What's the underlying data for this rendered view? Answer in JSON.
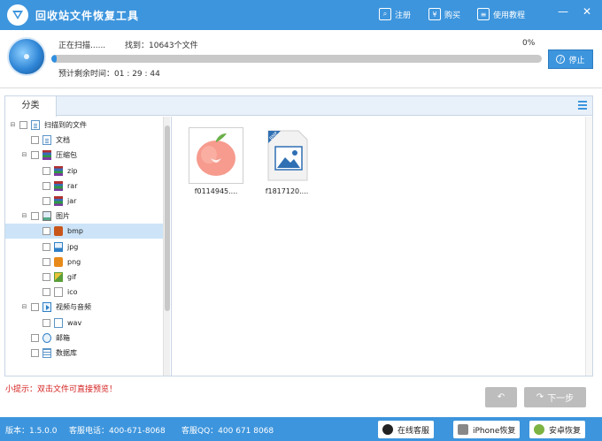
{
  "app": {
    "title": "回收站文件恢复工具"
  },
  "titlebar": {
    "register_label": "注册",
    "buy_label": "购买",
    "tutorial_label": "使用教程",
    "minimize_glyph": "—",
    "close_glyph": "✕"
  },
  "scan": {
    "status": "正在扫描......",
    "found": "找到：10643个文件",
    "percent": "0%",
    "progress_fraction": 0.01,
    "time_left": "预计剩余时间：01 : 29 : 44",
    "stop_label": "停止"
  },
  "panel": {
    "tab_label": "分类"
  },
  "tree": [
    {
      "label": "扫描到的文件",
      "icon": "doc",
      "expander": "⊟",
      "level": 0
    },
    {
      "label": "文档",
      "icon": "doc",
      "expander": "",
      "level": 1
    },
    {
      "label": "压缩包",
      "icon": "zip",
      "expander": "⊟",
      "level": 1
    },
    {
      "label": "zip",
      "icon": "zip",
      "expander": "",
      "level": 2
    },
    {
      "label": "rar",
      "icon": "zip",
      "expander": "",
      "level": 2
    },
    {
      "label": "jar",
      "icon": "zip",
      "expander": "",
      "level": 2
    },
    {
      "label": "图片",
      "icon": "img",
      "expander": "⊟",
      "level": 1
    },
    {
      "label": "bmp",
      "icon": "bmp",
      "expander": "",
      "level": 2,
      "selected": true
    },
    {
      "label": "jpg",
      "icon": "jpg",
      "expander": "",
      "level": 2
    },
    {
      "label": "png",
      "icon": "png",
      "expander": "",
      "level": 2
    },
    {
      "label": "gif",
      "icon": "gif",
      "expander": "",
      "level": 2
    },
    {
      "label": "ico",
      "icon": "ico",
      "expander": "",
      "level": 2
    },
    {
      "label": "视频与音频",
      "icon": "video",
      "expander": "⊟",
      "level": 1
    },
    {
      "label": "wav",
      "icon": "wav",
      "expander": "",
      "level": 2
    },
    {
      "label": "邮箱",
      "icon": "mail",
      "expander": "",
      "level": 1
    },
    {
      "label": "数据库",
      "icon": "db",
      "expander": "",
      "level": 1
    }
  ],
  "files": [
    {
      "name": "f0114945....",
      "kind": "apple-photo"
    },
    {
      "name": "f1817120....",
      "kind": "bmp-generic",
      "badge": "BMP"
    }
  ],
  "tip": "小提示：双击文件可直接预览！",
  "nav": {
    "back_glyph": "↶",
    "next_label": "下一步",
    "next_glyph": "↷"
  },
  "statusbar": {
    "version": "版本：1.5.0.0",
    "phone": "客服电话：400-671-8068",
    "qq": "客服QQ：400 671 8068",
    "online_service": "在线客服",
    "iphone_recovery": "iPhone恢复",
    "android_recovery": "安卓恢复"
  },
  "colors": {
    "accent": "#3d95dd",
    "tip": "#d42020",
    "selected_row": "#cde4f8"
  }
}
